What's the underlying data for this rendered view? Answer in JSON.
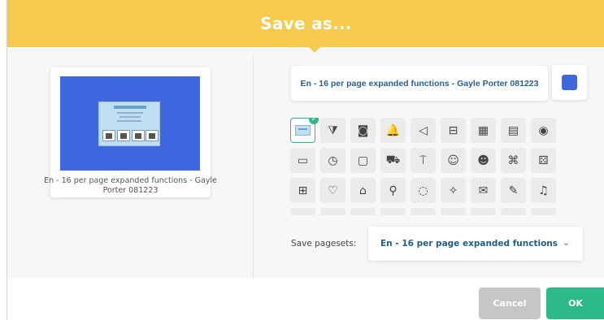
{
  "dialog": {
    "title": "Save as..."
  },
  "preview": {
    "name": "En - 16 per page expanded functions - Gayle Porter 081223"
  },
  "name_field": {
    "value": "En - 16 per page expanded functions - Gayle Porter 081223"
  },
  "color": {
    "selected": "#3e67df"
  },
  "icons": [
    {
      "name": "current-board-thumbnail",
      "glyph": "",
      "selected": true
    },
    {
      "name": "brain-icon",
      "glyph": "⧩"
    },
    {
      "name": "spiral-icon",
      "glyph": "◙"
    },
    {
      "name": "bell-icon",
      "glyph": "🔔"
    },
    {
      "name": "megaphone-icon",
      "glyph": "◁"
    },
    {
      "name": "briefcase-icon",
      "glyph": "⊟"
    },
    {
      "name": "calculator-icon",
      "glyph": "▦"
    },
    {
      "name": "calendar-icon",
      "glyph": "▤"
    },
    {
      "name": "camera-icon",
      "glyph": "◉"
    },
    {
      "name": "chat-bubbles-icon",
      "glyph": "▭"
    },
    {
      "name": "clock-icon",
      "glyph": "◷"
    },
    {
      "name": "speech-bubble-icon",
      "glyph": "▢"
    },
    {
      "name": "truck-icon",
      "glyph": "⛟"
    },
    {
      "name": "signpost-icon",
      "glyph": "⍑"
    },
    {
      "name": "smiley-icon",
      "glyph": "☺"
    },
    {
      "name": "happy-face-icon",
      "glyph": "☻"
    },
    {
      "name": "gamepad-icon",
      "glyph": "⌘"
    },
    {
      "name": "dice-icon",
      "glyph": "⚄"
    },
    {
      "name": "gift-icon",
      "glyph": "⊞"
    },
    {
      "name": "heart-icon",
      "glyph": "♡"
    },
    {
      "name": "home-icon",
      "glyph": "⌂"
    },
    {
      "name": "wrench-icon",
      "glyph": "⚲"
    },
    {
      "name": "lightbulb-icon",
      "glyph": "◌"
    },
    {
      "name": "magic-wand-icon",
      "glyph": "✧"
    },
    {
      "name": "mail-icon",
      "glyph": "✉"
    },
    {
      "name": "pen-icon",
      "glyph": "✎"
    },
    {
      "name": "music-note-icon",
      "glyph": "♫"
    },
    {
      "name": "partial-icon-1",
      "glyph": "◠"
    },
    {
      "name": "partial-icon-2",
      "glyph": "◠"
    },
    {
      "name": "partial-icon-3",
      "glyph": "◠"
    },
    {
      "name": "partial-icon-4",
      "glyph": "◠"
    },
    {
      "name": "partial-icon-5",
      "glyph": "◠"
    },
    {
      "name": "partial-icon-6",
      "glyph": "◠"
    },
    {
      "name": "partial-icon-7",
      "glyph": "◠"
    },
    {
      "name": "partial-icon-8",
      "glyph": "◠"
    },
    {
      "name": "partial-icon-9",
      "glyph": "◠"
    }
  ],
  "pagesets": {
    "label": "Save pagesets:",
    "value": "En - 16 per page expanded functions",
    "chevron": "⌄"
  },
  "footer": {
    "cancel_label": "Cancel",
    "ok_label": "OK"
  },
  "colors": {
    "header": "#f5ca4e",
    "ok": "#2cba8c",
    "cancel": "#c6c6c6",
    "accent": "#3e67df"
  }
}
